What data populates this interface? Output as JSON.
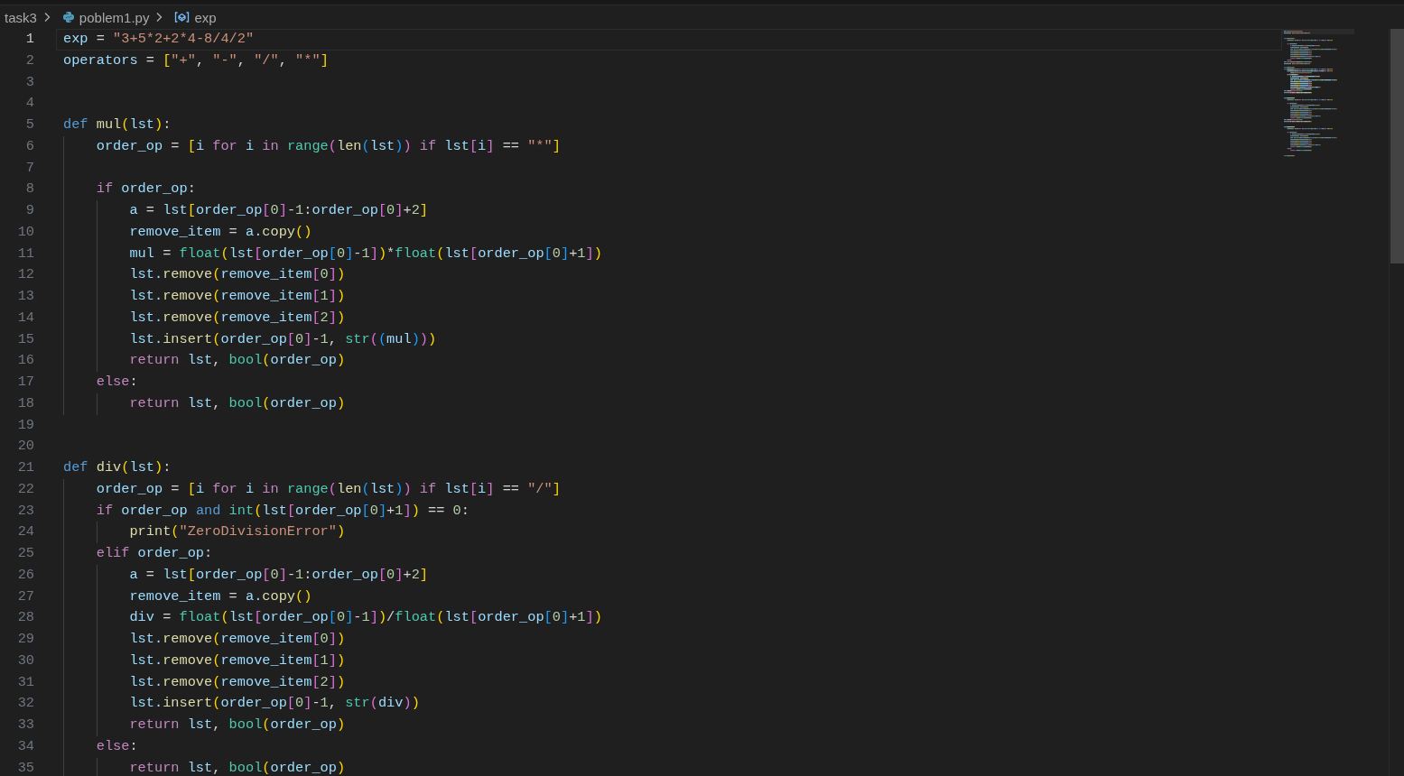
{
  "breadcrumb": [
    {
      "text": "task3",
      "kind": "folder"
    },
    {
      "text": "poblem1.py",
      "kind": "file"
    },
    {
      "text": "exp",
      "kind": "variable"
    }
  ],
  "lines": [
    {
      "number": "1",
      "current": true,
      "tokens": [
        {
          "text": "exp",
          "kind": "var"
        },
        {
          "text": " = ",
          "kind": "op"
        },
        {
          "text": "\"3+5*2+2*4-8/4/2\"",
          "kind": "str"
        }
      ]
    },
    {
      "number": "2",
      "current": false,
      "tokens": [
        {
          "text": "operators",
          "kind": "var"
        },
        {
          "text": " = ",
          "kind": "op"
        },
        {
          "text": "[",
          "kind": "p1"
        },
        {
          "text": "\"+\"",
          "kind": "str"
        },
        {
          "text": ", ",
          "kind": "op"
        },
        {
          "text": "\"-\"",
          "kind": "str"
        },
        {
          "text": ", ",
          "kind": "op"
        },
        {
          "text": "\"/\"",
          "kind": "str"
        },
        {
          "text": ", ",
          "kind": "op"
        },
        {
          "text": "\"*\"",
          "kind": "str"
        },
        {
          "text": "]",
          "kind": "p1"
        }
      ]
    },
    {
      "number": "3",
      "current": false
    },
    {
      "number": "4",
      "current": false
    },
    {
      "number": "5",
      "current": false,
      "tokens": [
        {
          "text": "def ",
          "kind": "storage"
        },
        {
          "text": "mul",
          "kind": "fn"
        },
        {
          "text": "(",
          "kind": "p1"
        },
        {
          "text": "lst",
          "kind": "var"
        },
        {
          "text": ")",
          "kind": "p1"
        },
        {
          "text": ":",
          "kind": "op"
        }
      ]
    },
    {
      "number": "6",
      "current": false,
      "tokens": [
        {
          "text": "    order_op",
          "kind": "var"
        },
        {
          "text": " = ",
          "kind": "op"
        },
        {
          "text": "[",
          "kind": "p1"
        },
        {
          "text": "i ",
          "kind": "var"
        },
        {
          "text": "for",
          "kind": "kw"
        },
        {
          "text": " i ",
          "kind": "var"
        },
        {
          "text": "in ",
          "kind": "kw"
        },
        {
          "text": "range",
          "kind": "type"
        },
        {
          "text": "(",
          "kind": "p2"
        },
        {
          "text": "len",
          "kind": "fn"
        },
        {
          "text": "(",
          "kind": "p3"
        },
        {
          "text": "lst",
          "kind": "var"
        },
        {
          "text": ")",
          "kind": "p3"
        },
        {
          "text": ")",
          "kind": "p2"
        },
        {
          "text": " if",
          "kind": "kw"
        },
        {
          "text": " lst",
          "kind": "var"
        },
        {
          "text": "[",
          "kind": "p2"
        },
        {
          "text": "i",
          "kind": "var"
        },
        {
          "text": "]",
          "kind": "p2"
        },
        {
          "text": " == ",
          "kind": "op"
        },
        {
          "text": "\"*\"",
          "kind": "str"
        },
        {
          "text": "]",
          "kind": "p1"
        }
      ]
    },
    {
      "number": "7",
      "current": false
    },
    {
      "number": "8",
      "current": false,
      "tokens": [
        {
          "text": "    if",
          "kind": "kw"
        },
        {
          "text": " order_op",
          "kind": "var"
        },
        {
          "text": ":",
          "kind": "op"
        }
      ]
    },
    {
      "number": "9",
      "current": false,
      "tokens": [
        {
          "text": "        a",
          "kind": "var"
        },
        {
          "text": " = ",
          "kind": "op"
        },
        {
          "text": "lst",
          "kind": "var"
        },
        {
          "text": "[",
          "kind": "p1"
        },
        {
          "text": "order_op",
          "kind": "var"
        },
        {
          "text": "[",
          "kind": "p2"
        },
        {
          "text": "0",
          "kind": "num"
        },
        {
          "text": "]",
          "kind": "p2"
        },
        {
          "text": "-",
          "kind": "op"
        },
        {
          "text": "1",
          "kind": "num"
        },
        {
          "text": ":",
          "kind": "op"
        },
        {
          "text": "order_op",
          "kind": "var"
        },
        {
          "text": "[",
          "kind": "p2"
        },
        {
          "text": "0",
          "kind": "num"
        },
        {
          "text": "]",
          "kind": "p2"
        },
        {
          "text": "+",
          "kind": "op"
        },
        {
          "text": "2",
          "kind": "num"
        },
        {
          "text": "]",
          "kind": "p1"
        }
      ]
    },
    {
      "number": "10",
      "current": false,
      "tokens": [
        {
          "text": "        remove_item",
          "kind": "var"
        },
        {
          "text": " = ",
          "kind": "op"
        },
        {
          "text": "a.",
          "kind": "var"
        },
        {
          "text": "copy",
          "kind": "fn"
        },
        {
          "text": "()",
          "kind": "p1"
        }
      ]
    },
    {
      "number": "11",
      "current": false,
      "tokens": [
        {
          "text": "        mul",
          "kind": "var"
        },
        {
          "text": " = ",
          "kind": "op"
        },
        {
          "text": "float",
          "kind": "type"
        },
        {
          "text": "(",
          "kind": "p1"
        },
        {
          "text": "lst",
          "kind": "var"
        },
        {
          "text": "[",
          "kind": "p2"
        },
        {
          "text": "order_op",
          "kind": "var"
        },
        {
          "text": "[",
          "kind": "p3"
        },
        {
          "text": "0",
          "kind": "num"
        },
        {
          "text": "]",
          "kind": "p3"
        },
        {
          "text": "-",
          "kind": "op"
        },
        {
          "text": "1",
          "kind": "num"
        },
        {
          "text": "]",
          "kind": "p2"
        },
        {
          "text": ")",
          "kind": "p1"
        },
        {
          "text": "*",
          "kind": "op"
        },
        {
          "text": "float",
          "kind": "type"
        },
        {
          "text": "(",
          "kind": "p1"
        },
        {
          "text": "lst",
          "kind": "var"
        },
        {
          "text": "[",
          "kind": "p2"
        },
        {
          "text": "order_op",
          "kind": "var"
        },
        {
          "text": "[",
          "kind": "p3"
        },
        {
          "text": "0",
          "kind": "num"
        },
        {
          "text": "]",
          "kind": "p3"
        },
        {
          "text": "+",
          "kind": "op"
        },
        {
          "text": "1",
          "kind": "num"
        },
        {
          "text": "]",
          "kind": "p2"
        },
        {
          "text": ")",
          "kind": "p1"
        }
      ]
    },
    {
      "number": "12",
      "current": false,
      "tokens": [
        {
          "text": "        lst.",
          "kind": "var"
        },
        {
          "text": "remove",
          "kind": "fn"
        },
        {
          "text": "(",
          "kind": "p1"
        },
        {
          "text": "remove_item",
          "kind": "var"
        },
        {
          "text": "[",
          "kind": "p2"
        },
        {
          "text": "0",
          "kind": "num"
        },
        {
          "text": "]",
          "kind": "p2"
        },
        {
          "text": ")",
          "kind": "p1"
        }
      ]
    },
    {
      "number": "13",
      "current": false,
      "tokens": [
        {
          "text": "        lst.",
          "kind": "var"
        },
        {
          "text": "remove",
          "kind": "fn"
        },
        {
          "text": "(",
          "kind": "p1"
        },
        {
          "text": "remove_item",
          "kind": "var"
        },
        {
          "text": "[",
          "kind": "p2"
        },
        {
          "text": "1",
          "kind": "num"
        },
        {
          "text": "]",
          "kind": "p2"
        },
        {
          "text": ")",
          "kind": "p1"
        }
      ]
    },
    {
      "number": "14",
      "current": false,
      "tokens": [
        {
          "text": "        lst.",
          "kind": "var"
        },
        {
          "text": "remove",
          "kind": "fn"
        },
        {
          "text": "(",
          "kind": "p1"
        },
        {
          "text": "remove_item",
          "kind": "var"
        },
        {
          "text": "[",
          "kind": "p2"
        },
        {
          "text": "2",
          "kind": "num"
        },
        {
          "text": "]",
          "kind": "p2"
        },
        {
          "text": ")",
          "kind": "p1"
        }
      ]
    },
    {
      "number": "15",
      "current": false,
      "tokens": [
        {
          "text": "        lst.",
          "kind": "var"
        },
        {
          "text": "insert",
          "kind": "fn"
        },
        {
          "text": "(",
          "kind": "p1"
        },
        {
          "text": "order_op",
          "kind": "var"
        },
        {
          "text": "[",
          "kind": "p2"
        },
        {
          "text": "0",
          "kind": "num"
        },
        {
          "text": "]",
          "kind": "p2"
        },
        {
          "text": "-",
          "kind": "op"
        },
        {
          "text": "1",
          "kind": "num"
        },
        {
          "text": ", ",
          "kind": "op"
        },
        {
          "text": "str",
          "kind": "type"
        },
        {
          "text": "(",
          "kind": "p2"
        },
        {
          "text": "(",
          "kind": "p3"
        },
        {
          "text": "mul",
          "kind": "var"
        },
        {
          "text": ")",
          "kind": "p3"
        },
        {
          "text": ")",
          "kind": "p2"
        },
        {
          "text": ")",
          "kind": "p1"
        }
      ]
    },
    {
      "number": "16",
      "current": false,
      "tokens": [
        {
          "text": "        return",
          "kind": "kw"
        },
        {
          "text": " lst",
          "kind": "var"
        },
        {
          "text": ", ",
          "kind": "op"
        },
        {
          "text": "bool",
          "kind": "type"
        },
        {
          "text": "(",
          "kind": "p1"
        },
        {
          "text": "order_op",
          "kind": "var"
        },
        {
          "text": ")",
          "kind": "p1"
        }
      ]
    },
    {
      "number": "17",
      "current": false,
      "tokens": [
        {
          "text": "    else",
          "kind": "kw"
        },
        {
          "text": ":",
          "kind": "op"
        }
      ]
    },
    {
      "number": "18",
      "current": false,
      "tokens": [
        {
          "text": "        return",
          "kind": "kw"
        },
        {
          "text": " lst",
          "kind": "var"
        },
        {
          "text": ", ",
          "kind": "op"
        },
        {
          "text": "bool",
          "kind": "type"
        },
        {
          "text": "(",
          "kind": "p1"
        },
        {
          "text": "order_op",
          "kind": "var"
        },
        {
          "text": ")",
          "kind": "p1"
        }
      ]
    },
    {
      "number": "19",
      "current": false
    },
    {
      "number": "20",
      "current": false
    },
    {
      "number": "21",
      "current": false,
      "tokens": [
        {
          "text": "def ",
          "kind": "storage"
        },
        {
          "text": "div",
          "kind": "fn"
        },
        {
          "text": "(",
          "kind": "p1"
        },
        {
          "text": "lst",
          "kind": "var"
        },
        {
          "text": ")",
          "kind": "p1"
        },
        {
          "text": ":",
          "kind": "op"
        }
      ]
    },
    {
      "number": "22",
      "current": false,
      "tokens": [
        {
          "text": "    order_op",
          "kind": "var"
        },
        {
          "text": " = ",
          "kind": "op"
        },
        {
          "text": "[",
          "kind": "p1"
        },
        {
          "text": "i ",
          "kind": "var"
        },
        {
          "text": "for",
          "kind": "kw"
        },
        {
          "text": " i ",
          "kind": "var"
        },
        {
          "text": "in ",
          "kind": "kw"
        },
        {
          "text": "range",
          "kind": "type"
        },
        {
          "text": "(",
          "kind": "p2"
        },
        {
          "text": "len",
          "kind": "fn"
        },
        {
          "text": "(",
          "kind": "p3"
        },
        {
          "text": "lst",
          "kind": "var"
        },
        {
          "text": ")",
          "kind": "p3"
        },
        {
          "text": ")",
          "kind": "p2"
        },
        {
          "text": " if",
          "kind": "kw"
        },
        {
          "text": " lst",
          "kind": "var"
        },
        {
          "text": "[",
          "kind": "p2"
        },
        {
          "text": "i",
          "kind": "var"
        },
        {
          "text": "]",
          "kind": "p2"
        },
        {
          "text": " == ",
          "kind": "op"
        },
        {
          "text": "\"/\"",
          "kind": "str"
        },
        {
          "text": "]",
          "kind": "p1"
        }
      ]
    },
    {
      "number": "23",
      "current": false,
      "tokens": [
        {
          "text": "    if",
          "kind": "kw"
        },
        {
          "text": " order_op ",
          "kind": "var"
        },
        {
          "text": "and ",
          "kind": "storage"
        },
        {
          "text": "int",
          "kind": "type"
        },
        {
          "text": "(",
          "kind": "p1"
        },
        {
          "text": "lst",
          "kind": "var"
        },
        {
          "text": "[",
          "kind": "p2"
        },
        {
          "text": "order_op",
          "kind": "var"
        },
        {
          "text": "[",
          "kind": "p3"
        },
        {
          "text": "0",
          "kind": "num"
        },
        {
          "text": "]",
          "kind": "p3"
        },
        {
          "text": "+",
          "kind": "op"
        },
        {
          "text": "1",
          "kind": "num"
        },
        {
          "text": "]",
          "kind": "p2"
        },
        {
          "text": ")",
          "kind": "p1"
        },
        {
          "text": " == ",
          "kind": "op"
        },
        {
          "text": "0",
          "kind": "num"
        },
        {
          "text": ":",
          "kind": "op"
        }
      ]
    },
    {
      "number": "24",
      "current": false,
      "tokens": [
        {
          "text": "        print",
          "kind": "fn"
        },
        {
          "text": "(",
          "kind": "p1"
        },
        {
          "text": "\"ZeroDivisionError\"",
          "kind": "str"
        },
        {
          "text": ")",
          "kind": "p1"
        }
      ]
    },
    {
      "number": "25",
      "current": false,
      "tokens": [
        {
          "text": "    elif",
          "kind": "kw"
        },
        {
          "text": " order_op",
          "kind": "var"
        },
        {
          "text": ":",
          "kind": "op"
        }
      ]
    },
    {
      "number": "26",
      "current": false,
      "tokens": [
        {
          "text": "        a",
          "kind": "var"
        },
        {
          "text": " = ",
          "kind": "op"
        },
        {
          "text": "lst",
          "kind": "var"
        },
        {
          "text": "[",
          "kind": "p1"
        },
        {
          "text": "order_op",
          "kind": "var"
        },
        {
          "text": "[",
          "kind": "p2"
        },
        {
          "text": "0",
          "kind": "num"
        },
        {
          "text": "]",
          "kind": "p2"
        },
        {
          "text": "-",
          "kind": "op"
        },
        {
          "text": "1",
          "kind": "num"
        },
        {
          "text": ":",
          "kind": "op"
        },
        {
          "text": "order_op",
          "kind": "var"
        },
        {
          "text": "[",
          "kind": "p2"
        },
        {
          "text": "0",
          "kind": "num"
        },
        {
          "text": "]",
          "kind": "p2"
        },
        {
          "text": "+",
          "kind": "op"
        },
        {
          "text": "2",
          "kind": "num"
        },
        {
          "text": "]",
          "kind": "p1"
        }
      ]
    },
    {
      "number": "27",
      "current": false,
      "tokens": [
        {
          "text": "        remove_item",
          "kind": "var"
        },
        {
          "text": " = ",
          "kind": "op"
        },
        {
          "text": "a.",
          "kind": "var"
        },
        {
          "text": "copy",
          "kind": "fn"
        },
        {
          "text": "()",
          "kind": "p1"
        }
      ]
    },
    {
      "number": "28",
      "current": false,
      "tokens": [
        {
          "text": "        div",
          "kind": "var"
        },
        {
          "text": " = ",
          "kind": "op"
        },
        {
          "text": "float",
          "kind": "type"
        },
        {
          "text": "(",
          "kind": "p1"
        },
        {
          "text": "lst",
          "kind": "var"
        },
        {
          "text": "[",
          "kind": "p2"
        },
        {
          "text": "order_op",
          "kind": "var"
        },
        {
          "text": "[",
          "kind": "p3"
        },
        {
          "text": "0",
          "kind": "num"
        },
        {
          "text": "]",
          "kind": "p3"
        },
        {
          "text": "-",
          "kind": "op"
        },
        {
          "text": "1",
          "kind": "num"
        },
        {
          "text": "]",
          "kind": "p2"
        },
        {
          "text": ")",
          "kind": "p1"
        },
        {
          "text": "/",
          "kind": "op"
        },
        {
          "text": "float",
          "kind": "type"
        },
        {
          "text": "(",
          "kind": "p1"
        },
        {
          "text": "lst",
          "kind": "var"
        },
        {
          "text": "[",
          "kind": "p2"
        },
        {
          "text": "order_op",
          "kind": "var"
        },
        {
          "text": "[",
          "kind": "p3"
        },
        {
          "text": "0",
          "kind": "num"
        },
        {
          "text": "]",
          "kind": "p3"
        },
        {
          "text": "+",
          "kind": "op"
        },
        {
          "text": "1",
          "kind": "num"
        },
        {
          "text": "]",
          "kind": "p2"
        },
        {
          "text": ")",
          "kind": "p1"
        }
      ]
    },
    {
      "number": "29",
      "current": false,
      "tokens": [
        {
          "text": "        lst.",
          "kind": "var"
        },
        {
          "text": "remove",
          "kind": "fn"
        },
        {
          "text": "(",
          "kind": "p1"
        },
        {
          "text": "remove_item",
          "kind": "var"
        },
        {
          "text": "[",
          "kind": "p2"
        },
        {
          "text": "0",
          "kind": "num"
        },
        {
          "text": "]",
          "kind": "p2"
        },
        {
          "text": ")",
          "kind": "p1"
        }
      ]
    },
    {
      "number": "30",
      "current": false,
      "tokens": [
        {
          "text": "        lst.",
          "kind": "var"
        },
        {
          "text": "remove",
          "kind": "fn"
        },
        {
          "text": "(",
          "kind": "p1"
        },
        {
          "text": "remove_item",
          "kind": "var"
        },
        {
          "text": "[",
          "kind": "p2"
        },
        {
          "text": "1",
          "kind": "num"
        },
        {
          "text": "]",
          "kind": "p2"
        },
        {
          "text": ")",
          "kind": "p1"
        }
      ]
    },
    {
      "number": "31",
      "current": false,
      "tokens": [
        {
          "text": "        lst.",
          "kind": "var"
        },
        {
          "text": "remove",
          "kind": "fn"
        },
        {
          "text": "(",
          "kind": "p1"
        },
        {
          "text": "remove_item",
          "kind": "var"
        },
        {
          "text": "[",
          "kind": "p2"
        },
        {
          "text": "2",
          "kind": "num"
        },
        {
          "text": "]",
          "kind": "p2"
        },
        {
          "text": ")",
          "kind": "p1"
        }
      ]
    },
    {
      "number": "32",
      "current": false,
      "tokens": [
        {
          "text": "        lst.",
          "kind": "var"
        },
        {
          "text": "insert",
          "kind": "fn"
        },
        {
          "text": "(",
          "kind": "p1"
        },
        {
          "text": "order_op",
          "kind": "var"
        },
        {
          "text": "[",
          "kind": "p2"
        },
        {
          "text": "0",
          "kind": "num"
        },
        {
          "text": "]",
          "kind": "p2"
        },
        {
          "text": "-",
          "kind": "op"
        },
        {
          "text": "1",
          "kind": "num"
        },
        {
          "text": ", ",
          "kind": "op"
        },
        {
          "text": "str",
          "kind": "type"
        },
        {
          "text": "(",
          "kind": "p2"
        },
        {
          "text": "div",
          "kind": "var"
        },
        {
          "text": ")",
          "kind": "p2"
        },
        {
          "text": ")",
          "kind": "p1"
        }
      ]
    },
    {
      "number": "33",
      "current": false,
      "tokens": [
        {
          "text": "        return",
          "kind": "kw"
        },
        {
          "text": " lst",
          "kind": "var"
        },
        {
          "text": ", ",
          "kind": "op"
        },
        {
          "text": "bool",
          "kind": "type"
        },
        {
          "text": "(",
          "kind": "p1"
        },
        {
          "text": "order_op",
          "kind": "var"
        },
        {
          "text": ")",
          "kind": "p1"
        }
      ]
    },
    {
      "number": "34",
      "current": false,
      "tokens": [
        {
          "text": "    else",
          "kind": "kw"
        },
        {
          "text": ":",
          "kind": "op"
        }
      ]
    },
    {
      "number": "35",
      "current": false,
      "tokens": [
        {
          "text": "        return",
          "kind": "kw"
        },
        {
          "text": " lst",
          "kind": "var"
        },
        {
          "text": ", ",
          "kind": "op"
        },
        {
          "text": "bool",
          "kind": "type"
        },
        {
          "text": "(",
          "kind": "p1"
        },
        {
          "text": "order_op",
          "kind": "var"
        },
        {
          "text": ")",
          "kind": "p1"
        }
      ]
    }
  ]
}
